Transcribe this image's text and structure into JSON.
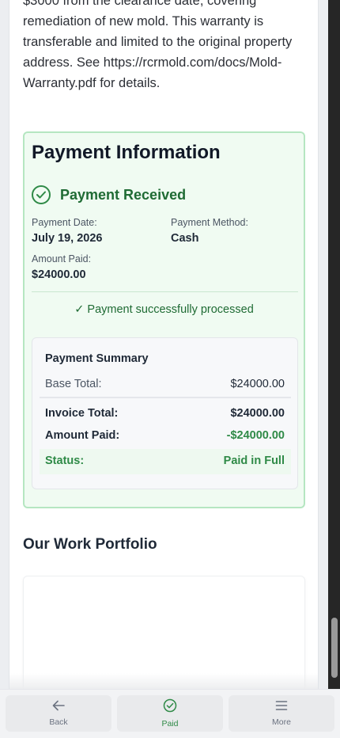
{
  "warranty": {
    "line1": "$3000 from the clearance date, covering",
    "line2": "remediation of new mold. This warranty is",
    "line3": "transferable and limited to the original property",
    "line4": "address. See https://rcrmold.com/docs/Mold-",
    "line5": "Warranty.pdf for details."
  },
  "payment": {
    "title": "Payment Information",
    "status_heading": "Payment Received",
    "date_label": "Payment Date:",
    "date_value": "July 19, 2026",
    "method_label": "Payment Method:",
    "method_value": "Cash",
    "amount_label": "Amount Paid:",
    "amount_value": "$24000.00",
    "success_message": "✓ Payment successfully processed",
    "summary": {
      "title": "Payment Summary",
      "base_total_label": "Base Total:",
      "base_total_value": "$24000.00",
      "invoice_total_label": "Invoice Total:",
      "invoice_total_value": "$24000.00",
      "amount_paid_label": "Amount Paid:",
      "amount_paid_value": "-$24000.00",
      "status_label": "Status:",
      "status_value": "Paid in Full"
    }
  },
  "portfolio": {
    "title": "Our Work Portfolio"
  },
  "nav": {
    "back": "Back",
    "paid": "Paid",
    "more": "More"
  },
  "colors": {
    "accent_green": "#2f8a47",
    "card_bg": "#f0fbf2",
    "card_border": "#b5e6c1"
  },
  "icons": {
    "received": "check-circle-icon",
    "back": "arrow-left-icon",
    "paid": "check-circle-icon",
    "more": "menu-icon"
  }
}
